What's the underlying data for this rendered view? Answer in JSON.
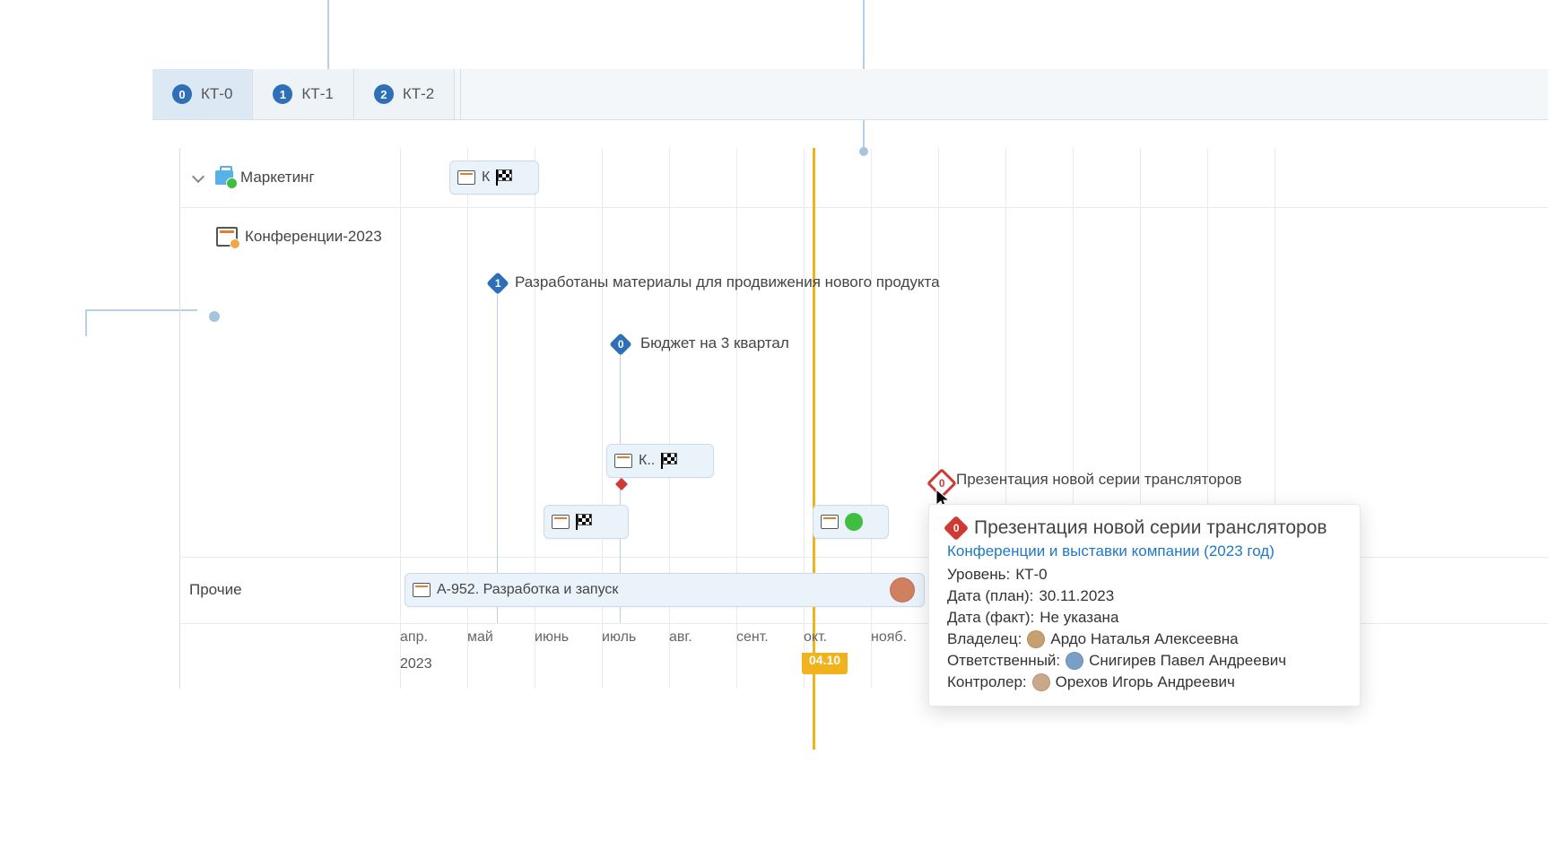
{
  "tabs": [
    {
      "badge": "0",
      "label": "КТ-0"
    },
    {
      "badge": "1",
      "label": "КТ-1"
    },
    {
      "badge": "2",
      "label": "КТ-2"
    }
  ],
  "sidebar": {
    "marketing": "Маркетинг",
    "conferences": "Конференции-2023",
    "other": "Прочие"
  },
  "timeline": {
    "today": "04.10",
    "year": "2023",
    "months": [
      "апр.",
      "май",
      "июнь",
      "июль",
      "авг.",
      "сент.",
      "окт.",
      "нояб."
    ]
  },
  "bars": {
    "bar1_label": "К",
    "bar2_label": "К..",
    "bar3_label": "",
    "bar4_label": "",
    "other_label": "А-952. Разработка и запуск"
  },
  "milestones": {
    "m1": {
      "badge": "1",
      "label": "Разработаны материалы для продвижения нового продукта"
    },
    "m2": {
      "badge": "0",
      "label": "Бюджет на 3 квартал"
    },
    "m3": {
      "badge": "0",
      "label": "Презентация новой серии трансляторов"
    }
  },
  "tooltip": {
    "badge": "0",
    "title": "Презентация новой серии трансляторов",
    "link": "Конференции и выставки компании (2023 год)",
    "level_label": "Уровень:",
    "level_value": "КТ-0",
    "plan_label": "Дата (план):",
    "plan_value": "30.11.2023",
    "fact_label": "Дата (факт):",
    "fact_value": "Не указана",
    "owner_label": "Владелец:",
    "owner_value": "Ардо Наталья Алексеевна",
    "resp_label": "Ответственный:",
    "resp_value": "Снигирев Павел Андреевич",
    "ctrl_label": "Контролер:",
    "ctrl_value": "Орехов Игорь Андреевич"
  }
}
